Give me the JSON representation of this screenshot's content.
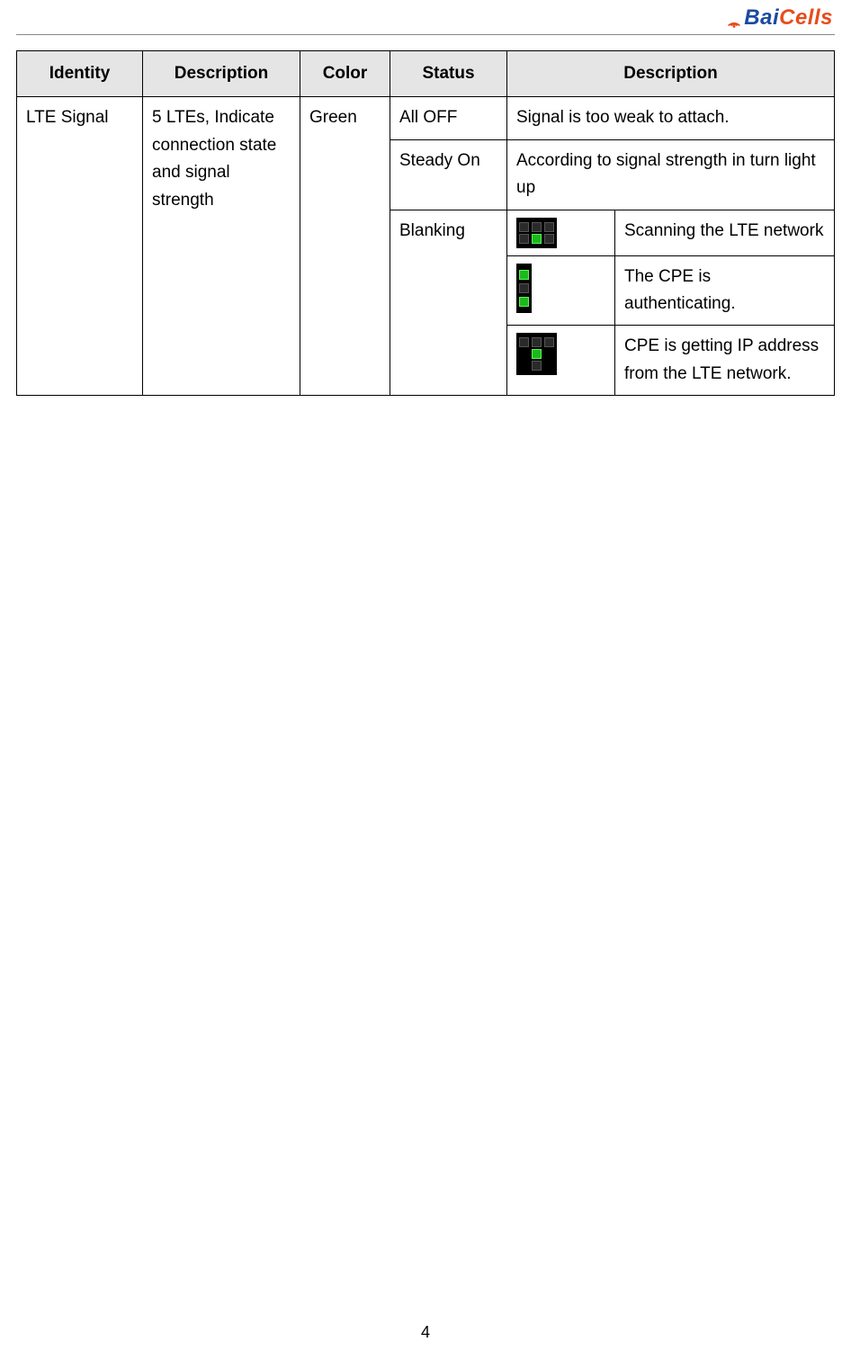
{
  "logo": {
    "part1": "Bai",
    "part2": "Cells"
  },
  "page_number": "4",
  "table": {
    "headers": [
      "Identity",
      "Description",
      "Color",
      "Status",
      "Description"
    ],
    "identity": "LTE Signal",
    "desc1": "5 LTEs, Indicate connection state and signal strength",
    "color": "Green",
    "rows": {
      "r1": {
        "status": "All OFF",
        "desc": "Signal is too weak to attach."
      },
      "r2": {
        "status": "Steady On",
        "desc": "According to signal strength in turn light up"
      },
      "r3": {
        "status": "Blanking",
        "sub": [
          {
            "icon": "scan",
            "desc": "Scanning the LTE network"
          },
          {
            "icon": "auth",
            "desc": "The CPE is authenticating."
          },
          {
            "icon": "ip",
            "desc": "CPE is getting IP address from the LTE network."
          }
        ]
      }
    }
  }
}
